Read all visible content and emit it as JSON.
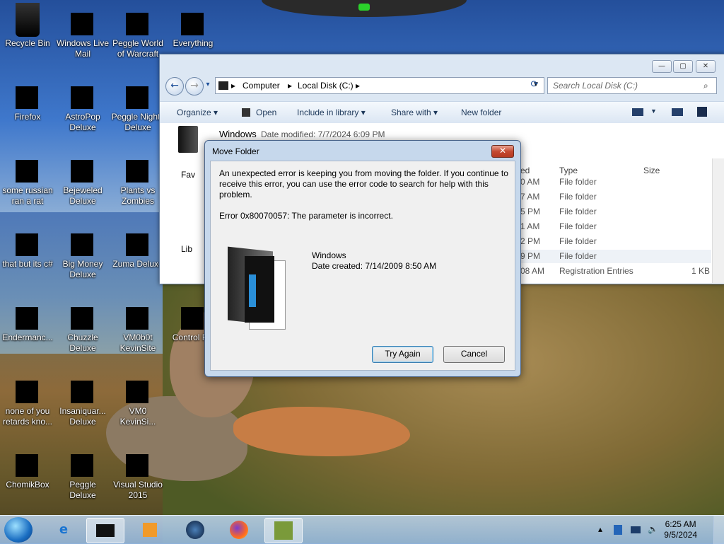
{
  "desktop": {
    "icons": [
      {
        "label": "Recycle Bin",
        "icon": "recycle-bin-icon"
      },
      {
        "label": "Windows Live Mail",
        "icon": "mail-icon"
      },
      {
        "label": "Peggle World of Warcraft",
        "icon": "peggle-icon"
      },
      {
        "label": "Everything",
        "icon": "everything-icon"
      },
      {
        "label": "Firefox",
        "icon": "firefox-icon"
      },
      {
        "label": "AstroPop Deluxe",
        "icon": "astropop-icon"
      },
      {
        "label": "Peggle Nights Deluxe",
        "icon": "peggle-icon"
      },
      {
        "label": "some russian ran a rat",
        "icon": "program-icon"
      },
      {
        "label": "Bejeweled Deluxe",
        "icon": "bejeweled-icon"
      },
      {
        "label": "Plants vs Zombies",
        "icon": "pvz-icon"
      },
      {
        "label": "that but its c#",
        "icon": "program-icon"
      },
      {
        "label": "Big Money Deluxe",
        "icon": "bigmoney-icon"
      },
      {
        "label": "Zuma Deluxe",
        "icon": "zuma-icon"
      },
      {
        "label": "Endermanc...",
        "icon": "program-icon"
      },
      {
        "label": "Chuzzle Deluxe",
        "icon": "chuzzle-icon"
      },
      {
        "label": "VM0b0t KevinSite",
        "icon": "program-icon"
      },
      {
        "label": "Control P...",
        "icon": "control-panel-icon"
      },
      {
        "label": "none of you retards kno...",
        "icon": "program-icon"
      },
      {
        "label": "Insaniquar... Deluxe",
        "icon": "insaniquarium-icon"
      },
      {
        "label": "VM0 KevinSi...",
        "icon": "program-icon"
      },
      {
        "label": "ChomikBox",
        "icon": "chomikbox-icon"
      },
      {
        "label": "Peggle Deluxe",
        "icon": "peggle-icon"
      },
      {
        "label": "Visual Studio 2015",
        "icon": "visual-studio-icon"
      }
    ]
  },
  "explorer": {
    "breadcrumb": [
      "Computer",
      "Local Disk (C:)"
    ],
    "search_placeholder": "Search Local Disk (C:)",
    "toolbar": {
      "organize": "Organize",
      "open": "Open",
      "include": "Include in library",
      "share": "Share with",
      "new_folder": "New folder"
    },
    "details": {
      "name": "Windows",
      "date_modified": "Date modified: 7/7/2024 6:09 PM"
    },
    "nav": {
      "favorites": "Fav",
      "libraries": "Lib"
    },
    "columns": {
      "date": "ed",
      "type": "Type",
      "size": "Size"
    },
    "rows": [
      {
        "date": "0 AM",
        "type": "File folder",
        "size": ""
      },
      {
        "date": "7 AM",
        "type": "File folder",
        "size": ""
      },
      {
        "date": "5 PM",
        "type": "File folder",
        "size": ""
      },
      {
        "date": "1 AM",
        "type": "File folder",
        "size": ""
      },
      {
        "date": "2 PM",
        "type": "File folder",
        "size": ""
      },
      {
        "date": "9 PM",
        "type": "File folder",
        "size": ""
      },
      {
        "date": "08 AM",
        "type": "Registration Entries",
        "size": "1 KB"
      }
    ]
  },
  "dialog": {
    "title": "Move Folder",
    "close": "✕",
    "message": "An unexpected error is keeping you from moving the folder. If you continue to receive this error, you can use the error code to search for help with this problem.",
    "error": "Error 0x80070057: The parameter is incorrect.",
    "item_name": "Windows",
    "item_date": "Date created: 7/14/2009 8:50 AM",
    "try_again": "Try Again",
    "cancel": "Cancel"
  },
  "taskbar": {
    "time": "6:25 AM",
    "date": "9/5/2024",
    "pinned": [
      "internet-explorer-icon",
      "explorer-icon",
      "media-player-icon",
      "globe-icon",
      "firefox-icon",
      "chomikbox-icon"
    ]
  }
}
